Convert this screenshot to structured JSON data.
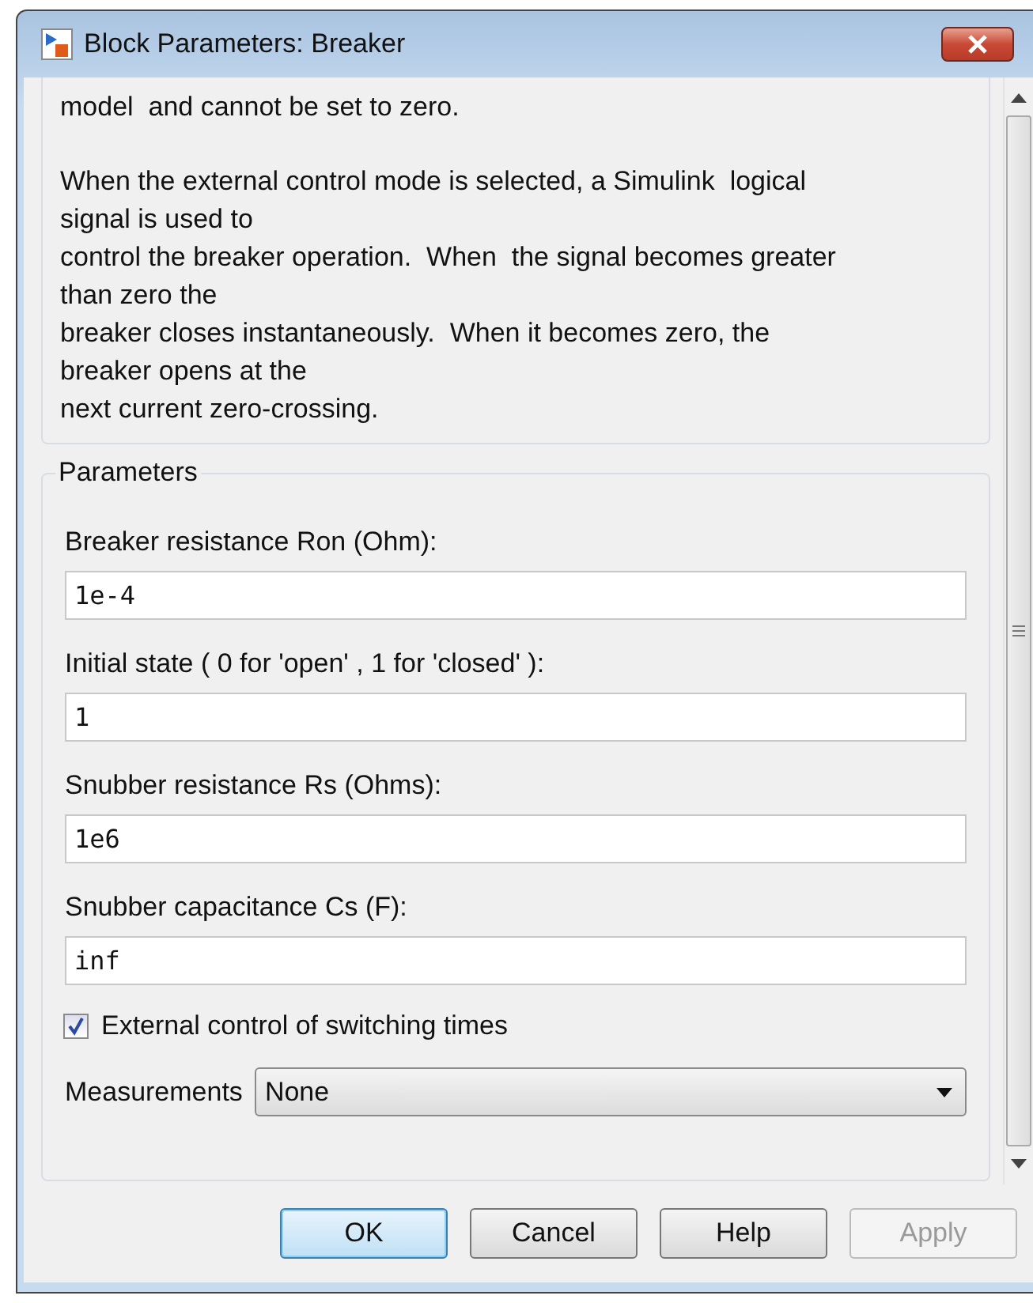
{
  "window": {
    "title": "Block Parameters: Breaker"
  },
  "description": {
    "paragraphs": [
      "model  and cannot be set to zero.",
      "When the external control mode is selected, a Simulink  logical\nsignal is used to\ncontrol the breaker operation.  When  the signal becomes greater\nthan zero the\nbreaker closes instantaneously.  When it becomes zero, the\nbreaker opens at the\nnext current zero-crossing."
    ]
  },
  "parameters": {
    "title": "Parameters",
    "fields": [
      {
        "label": "Breaker resistance Ron (Ohm):",
        "value": "1e-4"
      },
      {
        "label": "Initial state ( 0 for 'open' , 1 for 'closed' ):",
        "value": "1"
      },
      {
        "label": "Snubber resistance Rs (Ohms):",
        "value": "1e6"
      },
      {
        "label": "Snubber capacitance Cs (F):",
        "value": "inf"
      }
    ],
    "checkbox": {
      "label": "External control of switching times",
      "checked": true
    },
    "dropdown": {
      "label": "Measurements",
      "value": "None"
    }
  },
  "buttons": [
    {
      "label": "OK",
      "selected": true,
      "disabled": false
    },
    {
      "label": "Cancel",
      "selected": false,
      "disabled": false
    },
    {
      "label": "Help",
      "selected": false,
      "disabled": false
    },
    {
      "label": "Apply",
      "selected": false,
      "disabled": true
    }
  ]
}
